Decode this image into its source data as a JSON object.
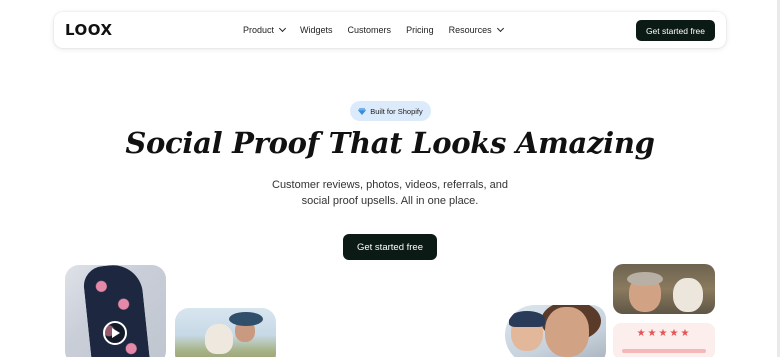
{
  "header": {
    "logo": "LOOX",
    "nav": [
      {
        "label": "Product",
        "has_dropdown": true
      },
      {
        "label": "Widgets",
        "has_dropdown": false
      },
      {
        "label": "Customers",
        "has_dropdown": false
      },
      {
        "label": "Pricing",
        "has_dropdown": false
      },
      {
        "label": "Resources",
        "has_dropdown": true
      }
    ],
    "cta": "Get started free"
  },
  "hero": {
    "badge": "Built for Shopify",
    "badge_icon": "diamond-icon",
    "title": "Social Proof That Looks Amazing",
    "subtitle_line1": "Customer reviews, photos, videos, referrals, and",
    "subtitle_line2": "social proof upsells. All in one place.",
    "cta": "Get started free"
  },
  "review_card": {
    "stars": "★★★★★",
    "rating": 5
  },
  "colors": {
    "primary_dark": "#0b1a14",
    "badge_bg": "#dcebfb",
    "star": "#e25555",
    "review_bg": "#fdeeee"
  }
}
